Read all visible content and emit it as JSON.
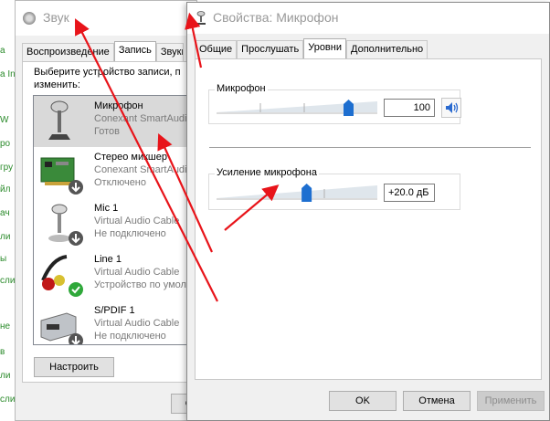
{
  "background": {
    "left_snippets": [
      "а",
      "а In",
      "W",
      "ро",
      "гру",
      "йл",
      "ач",
      "ли",
      "ы",
      "сли",
      "не",
      "в",
      "ли",
      "сли"
    ]
  },
  "sound_window": {
    "title": "Звук",
    "tabs": [
      {
        "label": "Воспроизведение"
      },
      {
        "label": "Запись"
      },
      {
        "label": "Звуки"
      }
    ],
    "prompt": "Выберите устройство записи, п изменить:",
    "devices": [
      {
        "name": "Микрофон",
        "driver": "Conexant SmartAudio",
        "status": "Готов"
      },
      {
        "name": "Стерео микшер",
        "driver": "Conexant SmartAudio",
        "status": "Отключено"
      },
      {
        "name": "Mic 1",
        "driver": "Virtual Audio Cable",
        "status": "Не подключено"
      },
      {
        "name": "Line 1",
        "driver": "Virtual Audio Cable",
        "status": "Устройство по умол"
      },
      {
        "name": "S/PDIF 1",
        "driver": "Virtual Audio Cable",
        "status": "Не подключено"
      }
    ],
    "configure_label": "Настроить",
    "ok_label": "О"
  },
  "properties_window": {
    "title": "Свойства: Микрофон",
    "tabs": [
      {
        "label": "Общие"
      },
      {
        "label": "Прослушать"
      },
      {
        "label": "Уровни"
      },
      {
        "label": "Дополнительно"
      }
    ],
    "microphone": {
      "label": "Микрофон",
      "value": "100",
      "level": 1.0
    },
    "boost": {
      "label": "Усиление микрофона",
      "value": "+20.0 дБ",
      "level": 0.67
    },
    "ok_label": "OK",
    "cancel_label": "Отмена",
    "apply_label": "Применить"
  },
  "colors": {
    "slider_thumb": "#1e6fd0",
    "arrow": "#e8141a",
    "background_text": "#2a8a2a"
  }
}
